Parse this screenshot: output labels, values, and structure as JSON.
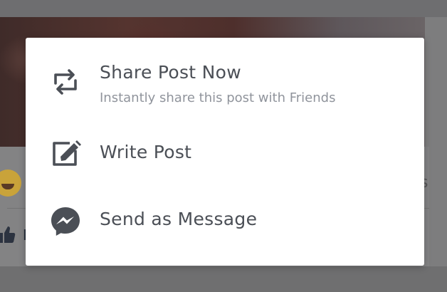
{
  "share_menu": {
    "items": [
      {
        "icon": "repost-icon",
        "title": "Share Post Now",
        "subtitle": "Instantly share this post with Friends"
      },
      {
        "icon": "compose-icon",
        "title": "Write Post"
      },
      {
        "icon": "messenger-icon",
        "title": "Send as Message"
      }
    ]
  },
  "background": {
    "partial_text_right": "s",
    "partial_text_like": "L",
    "colors": {
      "menu_background": "#ffffff",
      "icon_color": "#4b4f56",
      "title_color": "#4b4f56",
      "subtitle_color": "#90949c",
      "dim_overlay": "#7d7d7e"
    }
  }
}
